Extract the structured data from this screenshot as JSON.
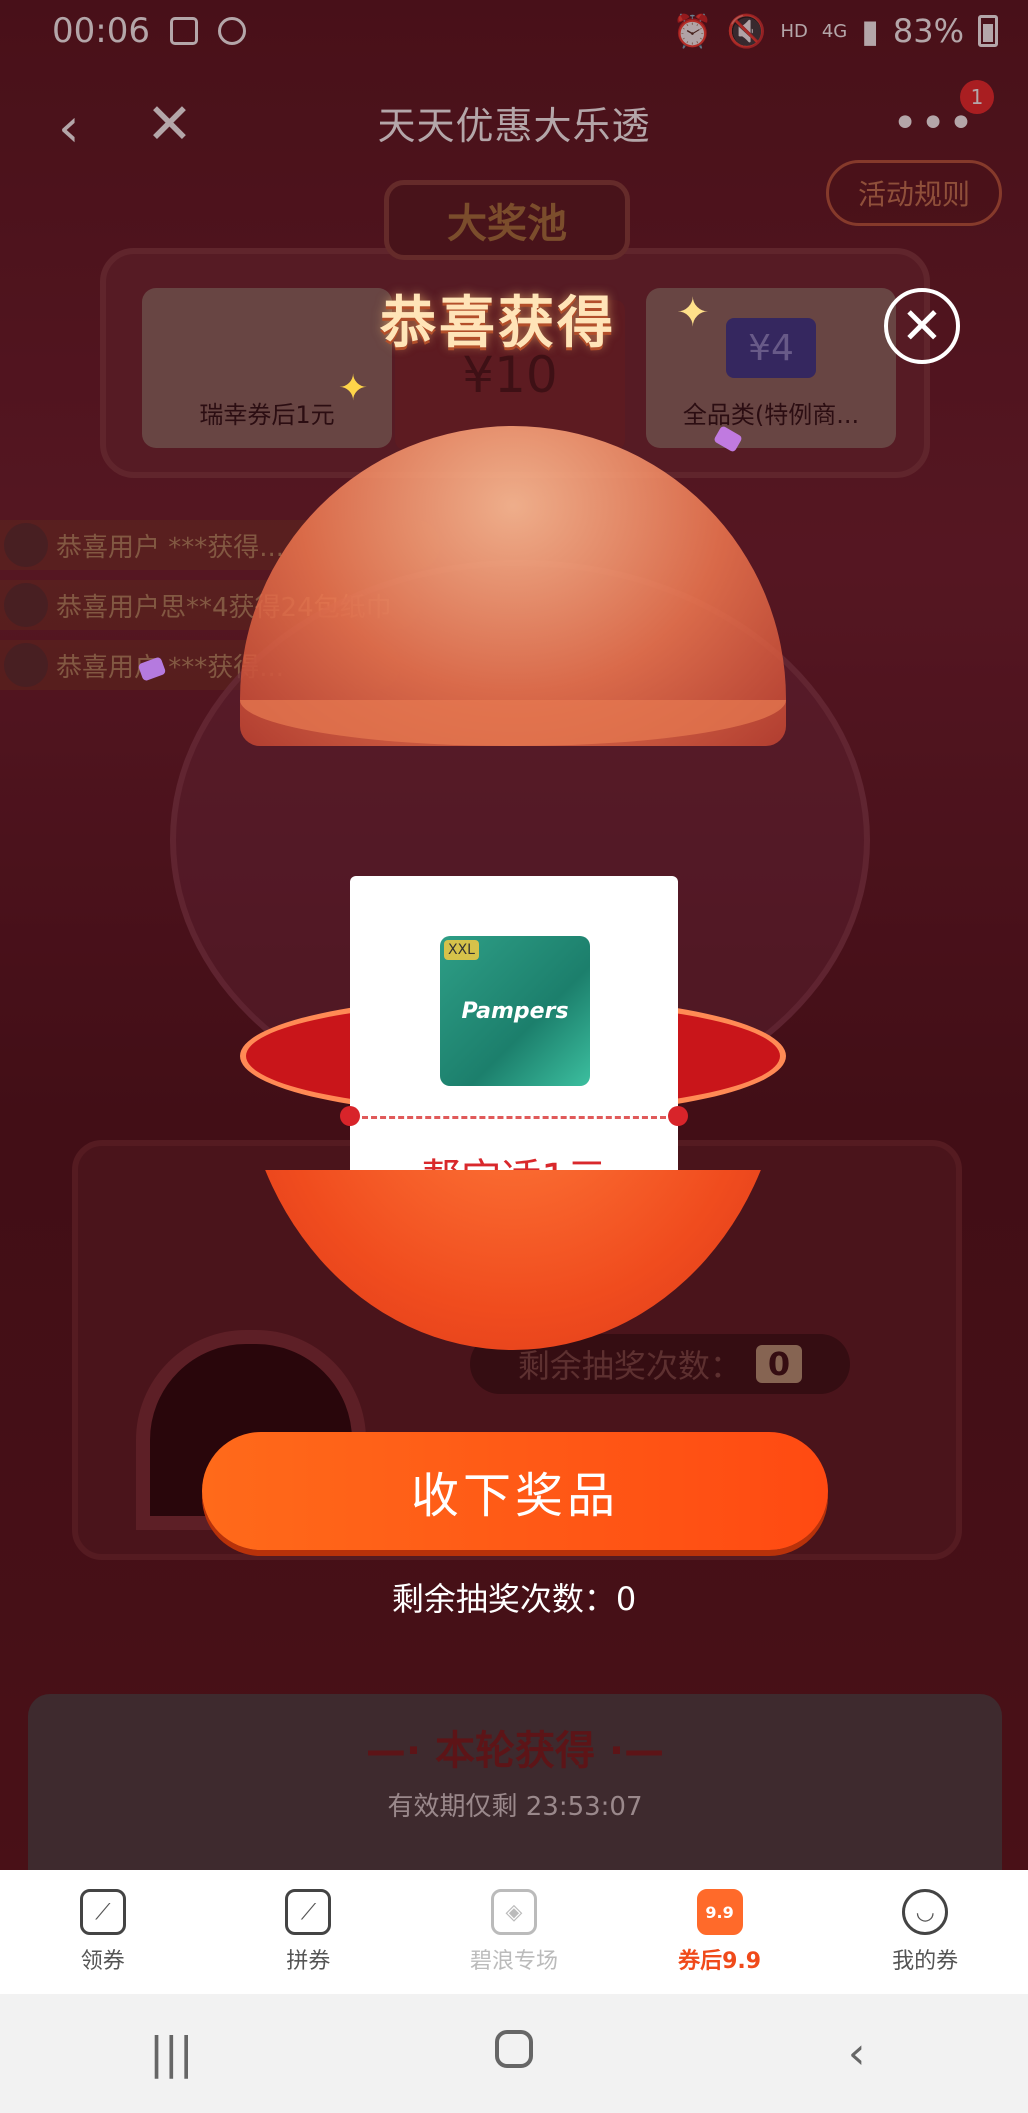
{
  "status_bar": {
    "time": "00:06",
    "network": "HD",
    "signal": "4G",
    "battery": "83%"
  },
  "title_bar": {
    "title": "天天优惠大乐透",
    "badge": "1"
  },
  "rules_label": "活动规则",
  "machine": {
    "pool_title": "大奖池",
    "prize_left": "瑞幸券后1元",
    "prize_mid": "¥10",
    "prize_right": "全品类(特例商...",
    "prize_right_coupon": "¥4",
    "remain_label": "剩余抽奖次数：",
    "remain_count": "0"
  },
  "tickers": [
    "恭喜用户 ***获得...",
    "恭喜用户思**4获得24包纸巾",
    "恭喜用户 ***获得..."
  ],
  "modal": {
    "heading": "恭喜获得",
    "prize_brand": "Pampers",
    "prize_size": "XXL",
    "prize_name": "帮宝适1元",
    "accept_label": "收下奖品",
    "remaining_text": "剩余抽奖次数：0"
  },
  "round_card": {
    "title": "—· 本轮获得 ·—",
    "subtitle": "有效期仅剩 23:53:07"
  },
  "tabs": [
    {
      "label": "领券",
      "icon": "coupon-icon"
    },
    {
      "label": "拼券",
      "icon": "group-coupon-icon"
    },
    {
      "label": "碧浪专场",
      "icon": "ariel-icon"
    },
    {
      "label": "券后9.9",
      "icon": "9.9"
    },
    {
      "label": "我的券",
      "icon": "smiley-icon"
    }
  ],
  "colors": {
    "accent": "#ff5a1a",
    "ticket_text": "#d9282c",
    "heading": "#ffe4b8"
  }
}
